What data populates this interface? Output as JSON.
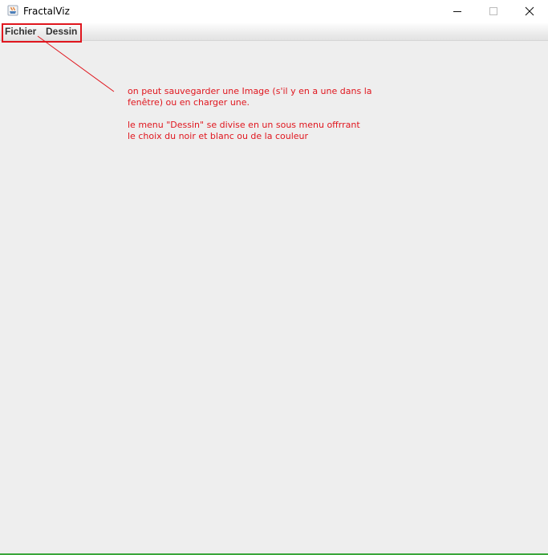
{
  "window": {
    "title": "FractalViz",
    "icon": "java-cup-icon"
  },
  "menubar": {
    "items": [
      {
        "label": "Fichier"
      },
      {
        "label": "Dessin"
      }
    ]
  },
  "annotation": {
    "lines": [
      "on peut sauvegarder une Image (s'il y en a une dans la",
      "fenêtre) ou en charger une.",
      "le menu \"Dessin\" se divise en un sous menu offrrant",
      "le choix du noir et blanc ou de la couleur"
    ],
    "color": "#e0161e"
  },
  "colors": {
    "content_background": "#eeeeee",
    "highlight": "#e0161e",
    "bottom_border": "#3aa63a"
  }
}
